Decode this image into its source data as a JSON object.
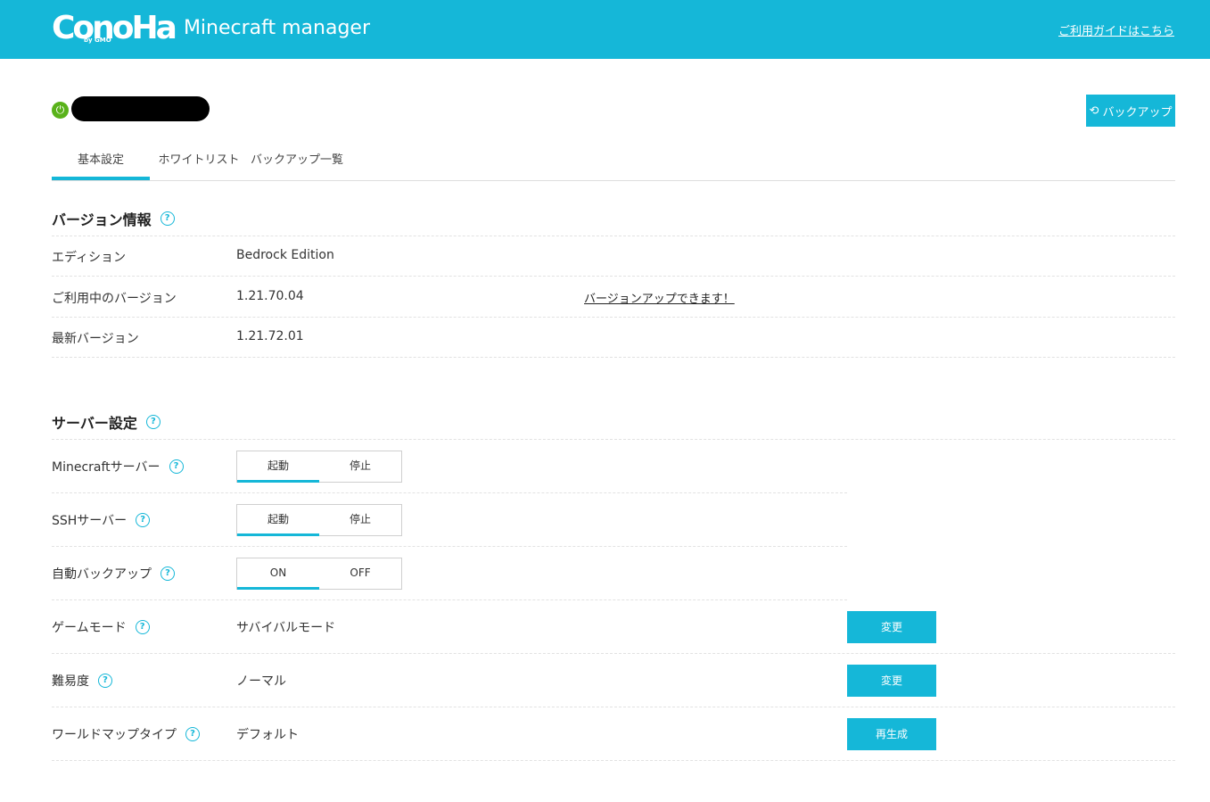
{
  "header": {
    "brand": "ConoHa",
    "brand_sub": "by GMO",
    "app_name": "Minecraft manager",
    "guide_link": "ご利用ガイドはこちら"
  },
  "server": {
    "status_icon": "power-icon",
    "backup_button": "バックアップ"
  },
  "tabs": [
    {
      "label": "基本設定",
      "active": true
    },
    {
      "label": "ホワイトリスト",
      "active": false
    },
    {
      "label": "バックアップ一覧",
      "active": false
    }
  ],
  "version_section": {
    "title": "バージョン情報",
    "rows": [
      {
        "label": "エディション",
        "value": "Bedrock Edition"
      },
      {
        "label": "ご利用中のバージョン",
        "value": "1.21.70.04",
        "link": "バージョンアップできます！"
      },
      {
        "label": "最新バージョン",
        "value": "1.21.72.01"
      }
    ]
  },
  "server_section": {
    "title": "サーバー設定",
    "toggles": [
      {
        "label": "Minecraftサーバー",
        "on_label": "起動",
        "off_label": "停止",
        "selected": "起動"
      },
      {
        "label": "SSHサーバー",
        "on_label": "起動",
        "off_label": "停止",
        "selected": "起動"
      },
      {
        "label": "自動バックアップ",
        "on_label": "ON",
        "off_label": "OFF",
        "selected": "ON"
      }
    ],
    "settings": [
      {
        "label": "ゲームモード",
        "value": "サバイバルモード",
        "button": "変更"
      },
      {
        "label": "難易度",
        "value": "ノーマル",
        "button": "変更"
      },
      {
        "label": "ワールドマップタイプ",
        "value": "デフォルト",
        "button": "再生成"
      }
    ]
  },
  "colors": {
    "accent": "#15b7d8",
    "status_green": "#59b21a"
  }
}
